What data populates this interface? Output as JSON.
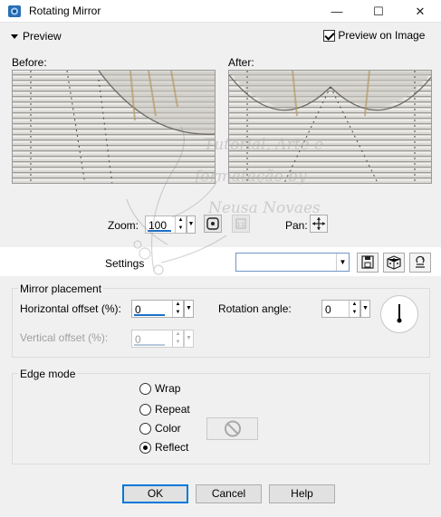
{
  "window": {
    "title": "Rotating Mirror",
    "controls": {
      "minimize": "—",
      "maximize": "☐",
      "close": "✕"
    }
  },
  "preview": {
    "toggle_label": "Preview",
    "on_image_label": "Preview on Image",
    "on_image_checked": true,
    "before_label": "Before:",
    "after_label": "After:"
  },
  "zoom": {
    "label": "Zoom:",
    "value": "100"
  },
  "pan": {
    "label": "Pan:"
  },
  "settings": {
    "label": "Settings",
    "value": ""
  },
  "mirror_placement": {
    "title": "Mirror placement",
    "horizontal_offset_label": "Horizontal offset (%):",
    "horizontal_offset_value": "0",
    "vertical_offset_label": "Vertical offset (%):",
    "vertical_offset_value": "0",
    "rotation_angle_label": "Rotation angle:",
    "rotation_angle_value": "0"
  },
  "edge_mode": {
    "title": "Edge mode",
    "options": [
      {
        "label": "Wrap",
        "selected": false
      },
      {
        "label": "Repeat",
        "selected": false
      },
      {
        "label": "Color",
        "selected": false
      },
      {
        "label": "Reflect",
        "selected": true
      }
    ]
  },
  "buttons": {
    "ok": "OK",
    "cancel": "Cancel",
    "help": "Help"
  },
  "watermark_text": [
    "Tutorial, Arte e",
    "formatação by",
    "Neusa Novaes"
  ],
  "icons": {
    "app": "app-icon",
    "proof": "proof-icon",
    "zoom-1to1": "actual-size-icon",
    "pan": "pan-move-icon",
    "save": "save-icon",
    "randomize": "dice-icon",
    "reset": "reset-icon",
    "no-color": "no-symbol-icon"
  },
  "colors": {
    "accent": "#0078d7",
    "focus_underline": "#1e6fc7"
  }
}
